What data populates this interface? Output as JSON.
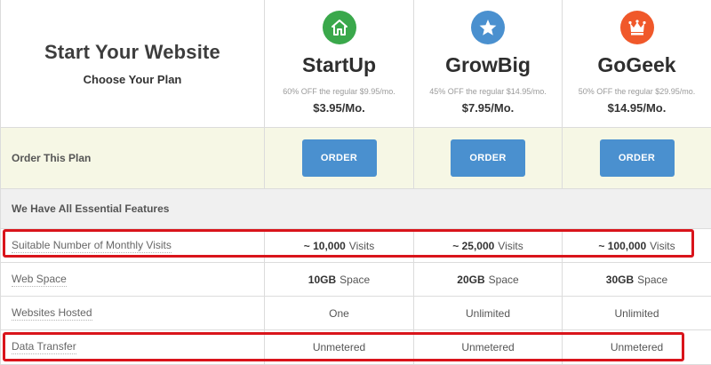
{
  "header": {
    "title": "Start Your Website",
    "subtitle": "Choose Your Plan"
  },
  "plans": [
    {
      "name": "StartUp",
      "icon": "home-icon",
      "color": "#3aa84b",
      "note": "60% OFF the regular $9.95/mo.",
      "price": "$3.95/Mo."
    },
    {
      "name": "GrowBig",
      "icon": "star-icon",
      "color": "#4a90cf",
      "note": "45% OFF the regular $14.95/mo.",
      "price": "$7.95/Mo."
    },
    {
      "name": "GoGeek",
      "icon": "crown-icon",
      "color": "#f0582a",
      "note": "50% OFF the regular $29.95/mo.",
      "price": "$14.95/Mo."
    }
  ],
  "order_row": {
    "label": "Order This Plan",
    "button_label": "ORDER",
    "button_color": "#4a90cf"
  },
  "features": {
    "header": "We Have All Essential Features",
    "rows": [
      {
        "label": "Suitable Number of Monthly Visits",
        "values": [
          {
            "strong": "~ 10,000",
            "rest": "Visits"
          },
          {
            "strong": "~ 25,000",
            "rest": "Visits"
          },
          {
            "strong": "~ 100,000",
            "rest": "Visits"
          }
        ]
      },
      {
        "label": "Web Space",
        "values": [
          {
            "strong": "10GB",
            "rest": "Space"
          },
          {
            "strong": "20GB",
            "rest": "Space"
          },
          {
            "strong": "30GB",
            "rest": "Space"
          }
        ]
      },
      {
        "label": "Websites Hosted",
        "values": [
          {
            "strong": "",
            "rest": "One"
          },
          {
            "strong": "",
            "rest": "Unlimited"
          },
          {
            "strong": "",
            "rest": "Unlimited"
          }
        ]
      },
      {
        "label": "Data Transfer",
        "values": [
          {
            "strong": "",
            "rest": "Unmetered"
          },
          {
            "strong": "",
            "rest": "Unmetered"
          },
          {
            "strong": "",
            "rest": "Unmetered"
          }
        ]
      }
    ]
  },
  "highlight_color": "#d9141b"
}
